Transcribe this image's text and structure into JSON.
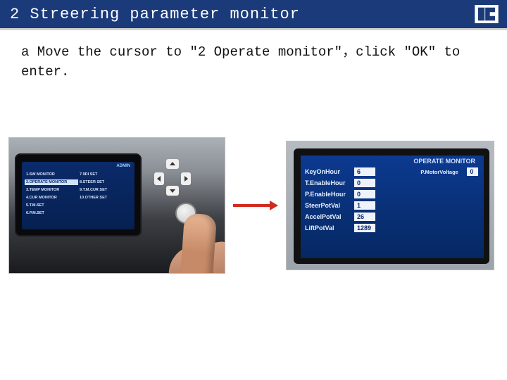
{
  "header": {
    "title": "2 Streering parameter monitor"
  },
  "instruction": "a Move the cursor to  \"2 Operate monitor\"，click \"OK\" to enter.",
  "left_screen": {
    "admin": "ADMIN",
    "col1": [
      "1.SW MONITOR",
      "2.OPERATE MONITOR",
      "3.TEMP MONITOR",
      "4.CUR MONITOR",
      "5.T.M.SET",
      "6.P.M.SET"
    ],
    "col2": [
      "7.9DI SET",
      "8.STEER SET",
      "9.T.M.CUR SET",
      "10.OTHER SET"
    ],
    "selected_index": 1
  },
  "right_screen": {
    "title": "OPERATE MONITOR",
    "main_rows": [
      {
        "label": "KeyOnHour",
        "value": "6"
      },
      {
        "label": "T.EnableHour",
        "value": "0"
      },
      {
        "label": "P.EnableHour",
        "value": "0"
      },
      {
        "label": "SteerPotVal",
        "value": "1"
      },
      {
        "label": "AccelPotVal",
        "value": "26"
      },
      {
        "label": "LiftPotVal",
        "value": "1289"
      }
    ],
    "side_rows": [
      {
        "label": "P.MotorVoltage",
        "value": "0"
      }
    ]
  }
}
